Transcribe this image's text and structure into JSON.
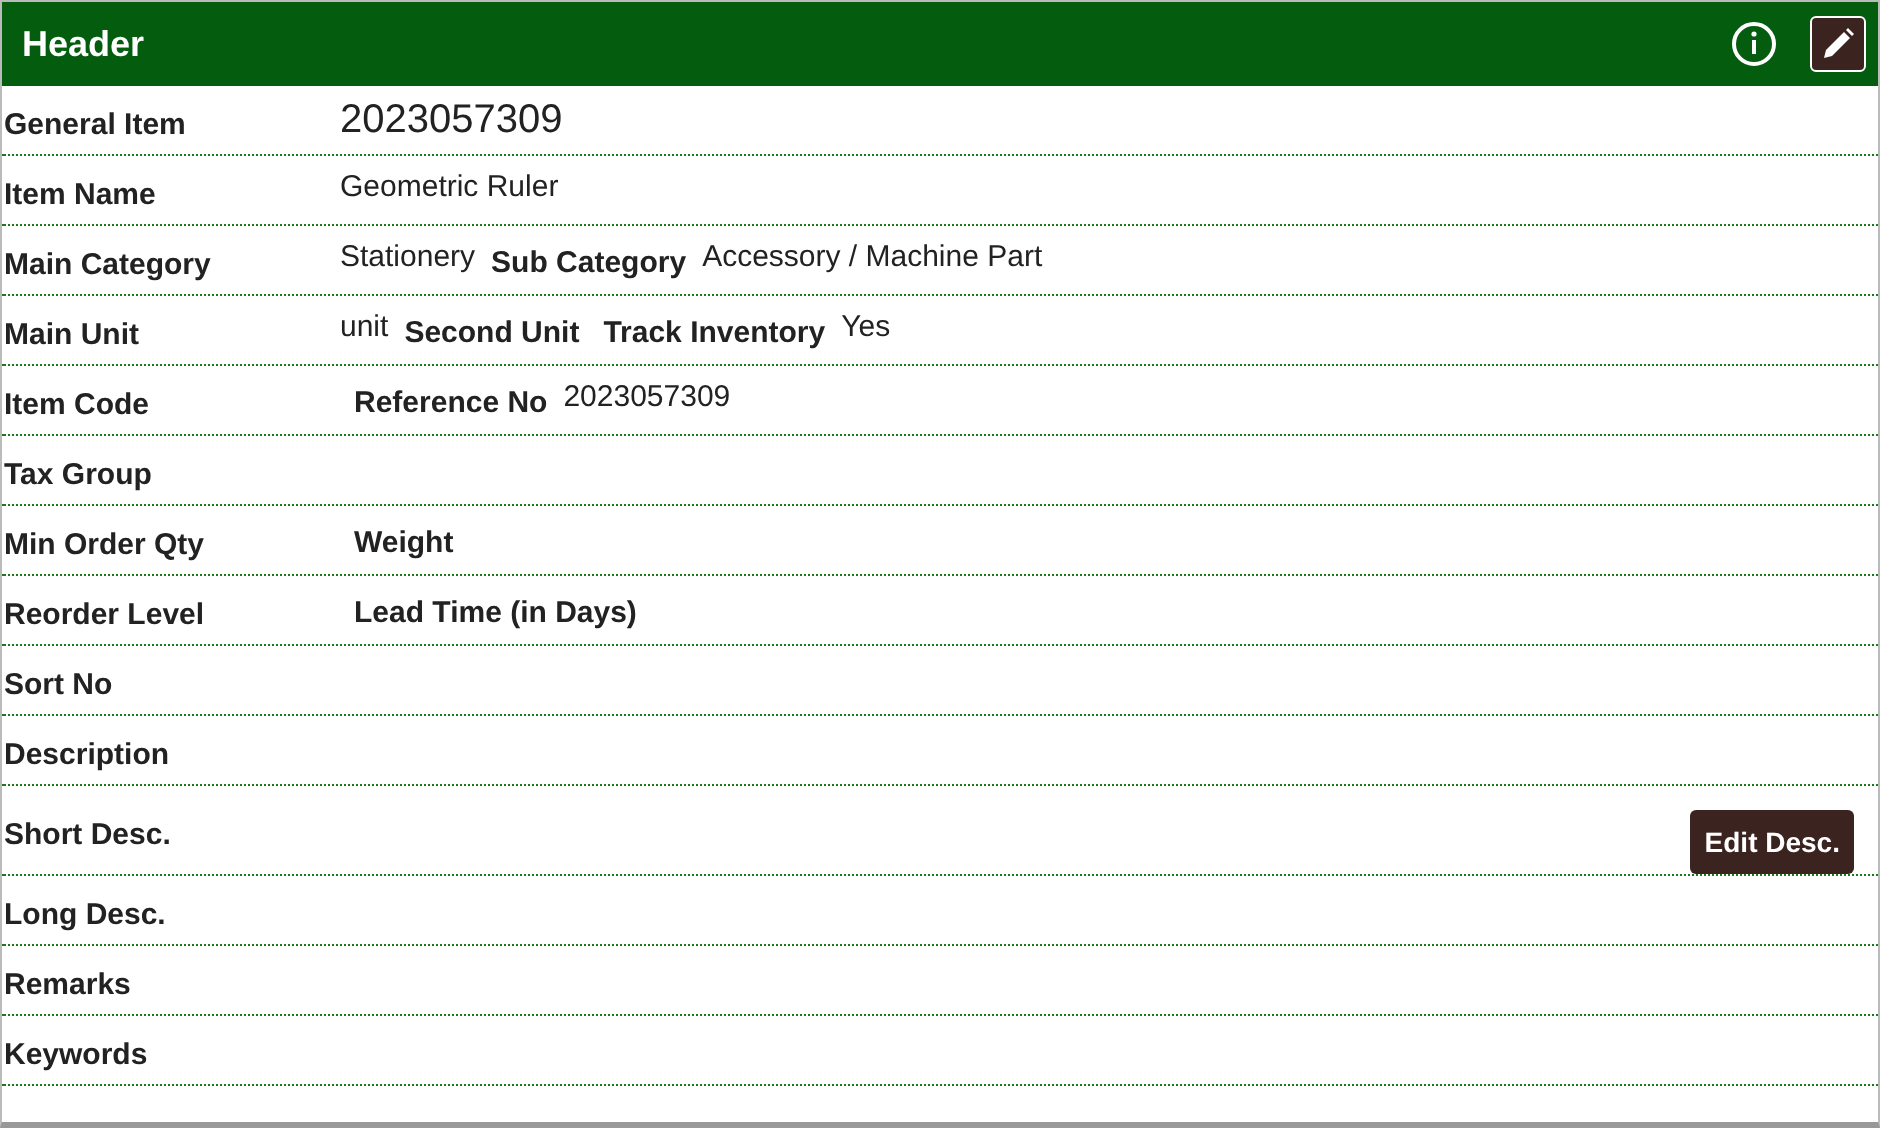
{
  "panel": {
    "title": "Header"
  },
  "rows": [
    {
      "label": "General Item",
      "fields": [
        {
          "kind": "big",
          "text": "2023057309"
        }
      ]
    },
    {
      "label": "Item Name",
      "fields": [
        {
          "kind": "value",
          "text": "Geometric Ruler"
        }
      ]
    },
    {
      "label": "Main Category",
      "fields": [
        {
          "kind": "value",
          "text": "Stationery"
        },
        {
          "kind": "label",
          "text": "Sub Category"
        },
        {
          "kind": "value",
          "text": "Accessory / Machine Part"
        }
      ]
    },
    {
      "label": "Main Unit",
      "fields": [
        {
          "kind": "value",
          "text": "unit"
        },
        {
          "kind": "label",
          "text": "Second Unit"
        },
        {
          "kind": "label",
          "text": "Track Inventory"
        },
        {
          "kind": "value",
          "text": "Yes"
        }
      ]
    },
    {
      "label": "Item Code",
      "fields": [
        {
          "kind": "label",
          "text": "Reference No"
        },
        {
          "kind": "value",
          "text": "2023057309"
        }
      ]
    },
    {
      "label": "Tax Group",
      "fields": []
    },
    {
      "label": "Min Order Qty",
      "fields": [
        {
          "kind": "label",
          "text": "Weight"
        }
      ]
    },
    {
      "label": "Reorder Level",
      "fields": [
        {
          "kind": "label",
          "text": "Lead Time (in Days)"
        }
      ]
    },
    {
      "label": "Sort No",
      "fields": []
    },
    {
      "label": "Description",
      "fields": []
    },
    {
      "label": "Short Desc.",
      "fields": [
        {
          "kind": "button",
          "text": "Edit Desc."
        }
      ]
    },
    {
      "label": "Long Desc.",
      "fields": []
    },
    {
      "label": "Remarks",
      "fields": []
    },
    {
      "label": "Keywords",
      "fields": []
    }
  ]
}
